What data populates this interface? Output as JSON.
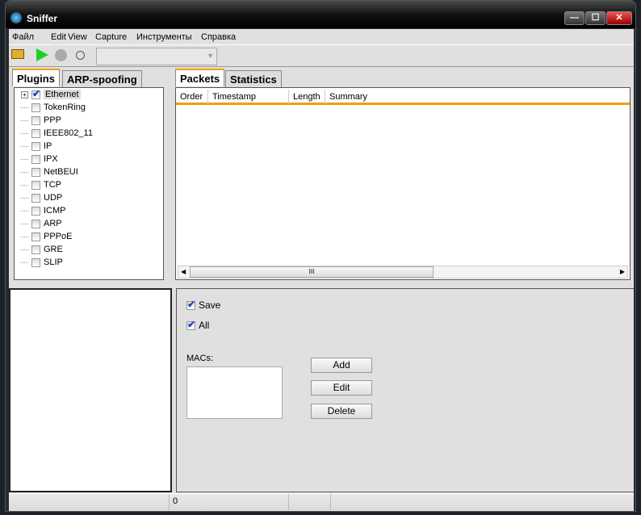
{
  "window": {
    "title": "Sniffer",
    "minimize": "—",
    "maximize": "☐",
    "close": "✕"
  },
  "menu": [
    "Файл",
    "Edit",
    "View",
    "Capture",
    "Инструменты",
    "Справка"
  ],
  "toolbar": {
    "icons": [
      "open-folder-icon",
      "play-icon",
      "stop-icon",
      "record-icon"
    ],
    "interface_select": ""
  },
  "left_tabs": [
    "Plugins",
    "ARP-spoofing"
  ],
  "plugins": [
    {
      "label": "Ethernet",
      "checked": true
    },
    {
      "label": "TokenRing",
      "checked": false
    },
    {
      "label": "PPP",
      "checked": false
    },
    {
      "label": "IEEE802_11",
      "checked": false
    },
    {
      "label": "IP",
      "checked": false
    },
    {
      "label": "IPX",
      "checked": false
    },
    {
      "label": "NetBEUI",
      "checked": false
    },
    {
      "label": "TCP",
      "checked": false
    },
    {
      "label": "UDP",
      "checked": false
    },
    {
      "label": "ICMP",
      "checked": false
    },
    {
      "label": "ARP",
      "checked": false
    },
    {
      "label": "PPPoE",
      "checked": false
    },
    {
      "label": "GRE",
      "checked": false
    },
    {
      "label": "SLIP",
      "checked": false
    }
  ],
  "right_tabs": [
    "Packets",
    "Statistics"
  ],
  "packets": {
    "columns": [
      "Order",
      "Timestamp",
      "Length",
      "Summary"
    ],
    "rows": [],
    "scroll_grip": "III"
  },
  "options": {
    "save_label": "Save",
    "save_checked": true,
    "all_label": "All",
    "all_checked": true,
    "macs_label": "MACs:",
    "add": "Add",
    "edit": "Edit",
    "delete": "Delete"
  },
  "status": {
    "count": "0"
  }
}
